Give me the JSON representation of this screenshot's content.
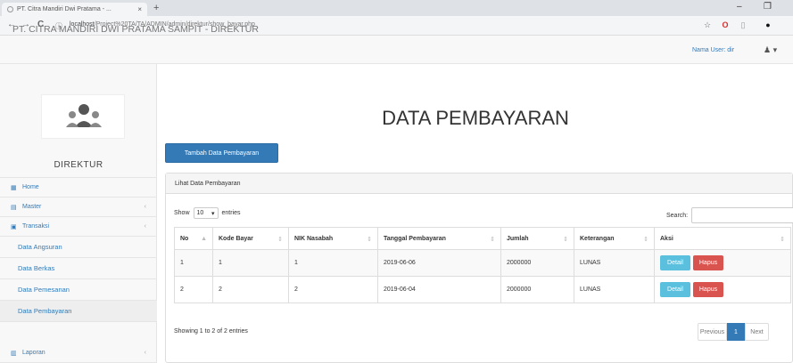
{
  "browser": {
    "tab_title": "PT. Citra Mandiri Dwi Pratama - ...",
    "tab_close": "×",
    "new_tab": "+",
    "back": "←",
    "forward": "→",
    "reload": "C",
    "url_host": "localhost",
    "url_path": "/Project%20TA/TA/ADMIN/admin/direktur/show_bayar.php",
    "window_minimize": "–",
    "window_maximize": "❐"
  },
  "header": {
    "brand": "PT. CITRA MANDIRI DWI PRATAMA SAMPIT - DIREKTUR",
    "user_label": "Nama User: dir"
  },
  "sidebar": {
    "profile_name": "DIREKTUR",
    "items": [
      {
        "label": "Home",
        "icon": "dashboard-icon",
        "has_arrow": false
      },
      {
        "label": "Master",
        "icon": "sitemap-icon",
        "has_arrow": true
      },
      {
        "label": "Transaksi",
        "icon": "file-icon",
        "has_arrow": true
      }
    ],
    "sub_items": [
      {
        "label": "Data Angsuran"
      },
      {
        "label": "Data Berkas"
      },
      {
        "label": "Data Pemesanan"
      },
      {
        "label": "Data Pembayaran"
      }
    ],
    "laporan": {
      "label": "Laporan",
      "icon": "chart-icon"
    }
  },
  "main": {
    "title": "DATA PEMBAYARAN",
    "add_button": "Tambah Data Pembayaran",
    "panel_heading": "Lihat Data Pembayaran",
    "show_label": "Show",
    "show_value": "10",
    "entries_label": "entries",
    "search_label": "Search:",
    "columns": [
      "No",
      "Kode Bayar",
      "NIK Nasabah",
      "Tanggal Pembayaran",
      "Jumlah",
      "Keterangan",
      "Aksi"
    ],
    "rows": [
      {
        "no": "1",
        "kode": "1",
        "nik": "1",
        "tanggal": "2019-06-06",
        "jumlah": "2000000",
        "keterangan": "LUNAS"
      },
      {
        "no": "2",
        "kode": "2",
        "nik": "2",
        "tanggal": "2019-06-04",
        "jumlah": "2000000",
        "keterangan": "LUNAS"
      }
    ],
    "detail_label": "Detail",
    "hapus_label": "Hapus",
    "info": "Showing 1 to 2 of 2 entries",
    "prev": "Previous",
    "page": "1",
    "next": "Next"
  },
  "colors": {
    "primary": "#337ab7",
    "info": "#5bc0de",
    "danger": "#d9534f"
  }
}
